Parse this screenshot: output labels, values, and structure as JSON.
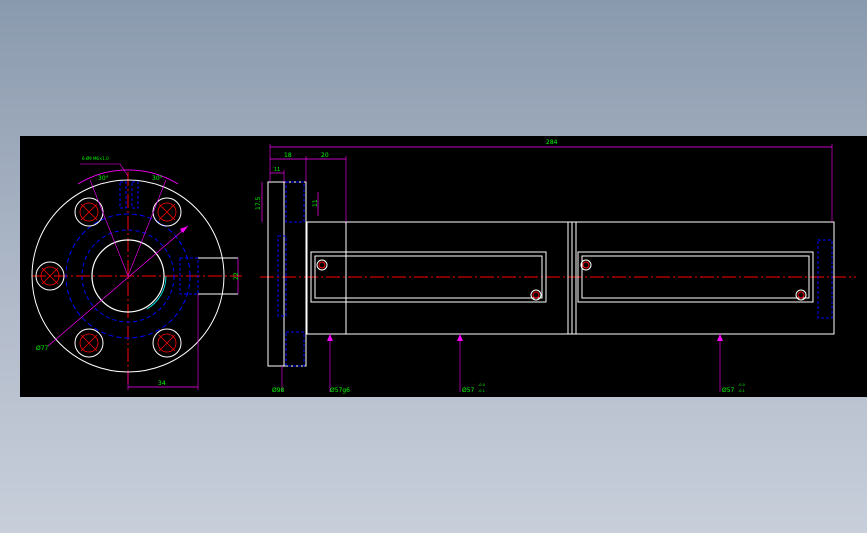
{
  "drawing": {
    "note_hole": "6-Ø9 M6×1.0",
    "angle_left": "30°",
    "angle_right": "30°",
    "dim_width_34": "34",
    "dim_height_22": "22",
    "dim_dia_77": "Ø77",
    "dim_17_5": "17.5",
    "dim_11_top": "11",
    "dim_11_side": "11",
    "dim_18": "18",
    "dim_20": "20",
    "dim_284": "284",
    "dim_dia_98": "Ø98",
    "dim_dia_57g6": "Ø57g6",
    "dim_dia_57_a": "Ø57",
    "dim_dia_57_a_tol_up": "-0.0",
    "dim_dia_57_a_tol_dn": "-0.1",
    "dim_dia_57_b": "Ø57",
    "dim_dia_57_b_tol_up": "-0.0",
    "dim_dia_57_b_tol_dn": "-0.1"
  },
  "colors": {
    "background": "#000000",
    "outline": "#ffffff",
    "dimension": "#ff00ff",
    "text": "#00ff00",
    "centerline": "#ff0000",
    "hidden": "#0000ff",
    "accent": "#00ffff"
  }
}
